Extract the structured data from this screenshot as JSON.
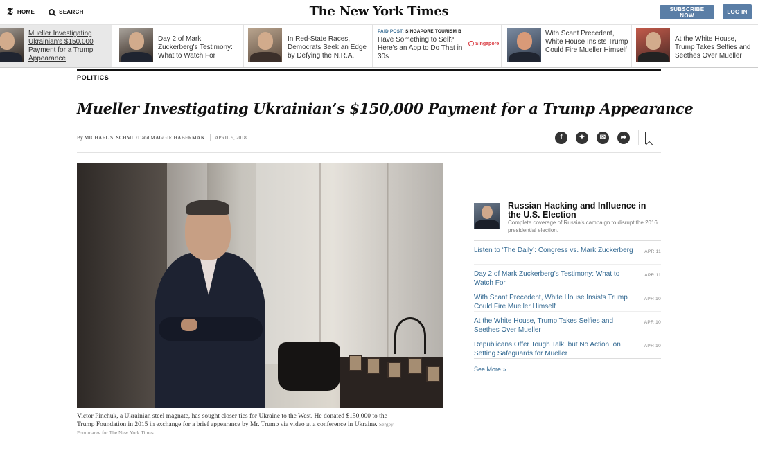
{
  "masthead": {
    "home_label": "HOME",
    "search_label": "SEARCH",
    "logo_text": "The New York Times",
    "subscribe_label": "SUBSCRIBE NOW",
    "login_label": "LOG IN"
  },
  "ribbon": [
    {
      "text": "Mueller Investigating Ukrainian's $150,000 Payment for a Trump Appearance"
    },
    {
      "text": "Day 2 of Mark Zuckerberg's Testimony: What to Watch For"
    },
    {
      "text": "In Red-State Races, Democrats Seek an Edge by Defying the N.R.A."
    },
    {
      "paid_label": "PAID POST:",
      "sponsor_caps": "SINGAPORE TOURISM B",
      "text": "Have Something to Sell? Here's an App to Do That in 30s",
      "sponsor_logo": "Singapore"
    },
    {
      "text": "With Scant Precedent, White House Insists Trump Could Fire Mueller Himself"
    },
    {
      "text": "At the White House, Trump Takes Selfies and Seethes Over Mueller"
    }
  ],
  "article": {
    "kicker": "POLITICS",
    "headline": "Mueller Investigating Ukrainian’s $150,000 Payment for a Trump Appearance",
    "byline_by": "By",
    "author1": "MICHAEL S. SCHMIDT",
    "byline_and": "and",
    "author2": "MAGGIE HABERMAN",
    "date": "APRIL 9, 2018",
    "caption": "Victor Pinchuk, a Ukrainian steel magnate, has sought closer ties for Ukraine to the West. He donated $150,000 to the Trump Foundation in 2015 in exchange for a brief appearance by Mr. Trump via video at a conference in Ukraine.",
    "credit": "Sergey Ponomarev for The New York Times"
  },
  "share_icons": [
    "facebook-icon",
    "twitter-icon",
    "email-icon",
    "share-icon"
  ],
  "sidebar": {
    "title": "Russian Hacking and Influence in the U.S. Election",
    "description": "Complete coverage of Russia's campaign to disrupt the 2016 presidential election.",
    "items": [
      {
        "headline": "Listen to ‘The Daily’: Congress vs. Mark Zuckerberg",
        "date": "APR 11"
      },
      {
        "headline": "Day 2 of Mark Zuckerberg’s Testimony: What to Watch For",
        "date": "APR 11"
      },
      {
        "headline": "With Scant Precedent, White House Insists Trump Could Fire Mueller Himself",
        "date": "APR 10"
      },
      {
        "headline": "At the White House, Trump Takes Selfies and Seethes Over Mueller",
        "date": "APR 10"
      },
      {
        "headline": "Republicans Offer Tough Talk, but No Action, on Setting Safeguards for Mueller",
        "date": "APR 10"
      }
    ],
    "see_more": "See More »"
  }
}
